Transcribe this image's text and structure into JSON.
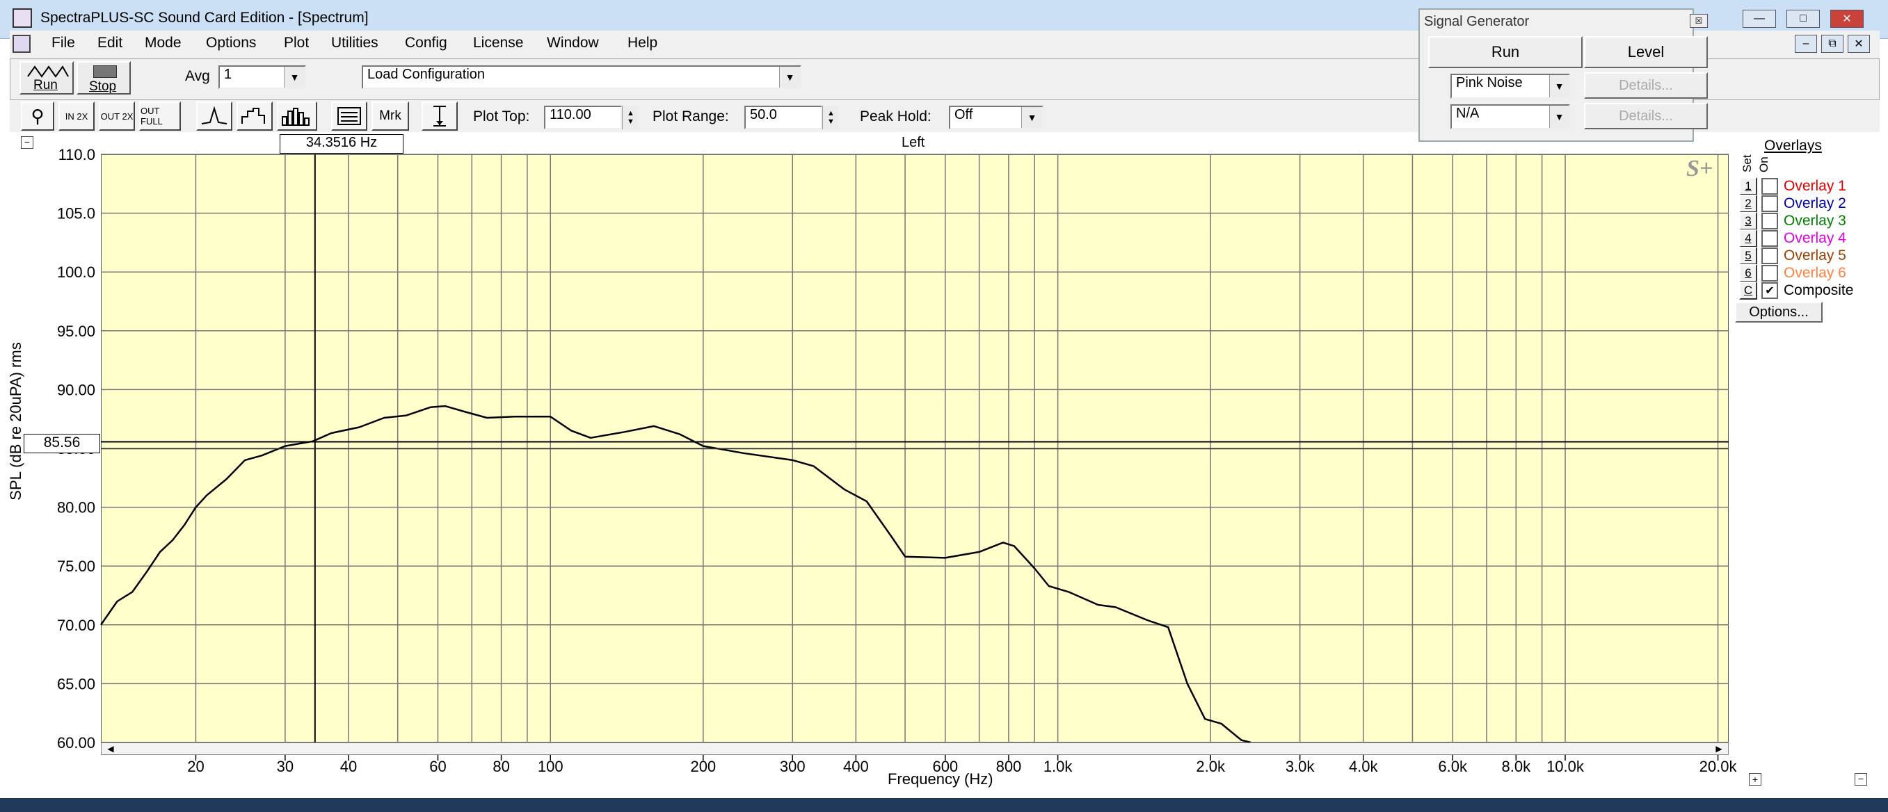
{
  "window": {
    "title": "SpectraPLUS-SC Sound Card Edition - [Spectrum]"
  },
  "menu": [
    "File",
    "Edit",
    "Mode",
    "Options",
    "Plot",
    "Utilities",
    "Config",
    "License",
    "Window",
    "Help"
  ],
  "toolbar": {
    "run_label": "Run",
    "stop_label": "Stop",
    "avg_label": "Avg",
    "avg_value": "1",
    "config_value": "Load Configuration"
  },
  "toolbar2": {
    "mrk_label": "Mrk",
    "plot_top_label": "Plot Top:",
    "plot_top_value": "110.00",
    "plot_range_label": "Plot Range:",
    "plot_range_value": "50.0",
    "peak_hold_label": "Peak Hold:",
    "peak_hold_value": "Off"
  },
  "signal_generator": {
    "title": "Signal Generator",
    "run_label": "Run",
    "level_label": "Level",
    "gen1_value": "Pink Noise",
    "gen2_value": "N/A",
    "details1_label": "Details...",
    "details2_label": "Details..."
  },
  "plot": {
    "cursor_readout": "34.3516 Hz",
    "channel_label": "Left",
    "cursor_level": "85.56",
    "watermark": "S+"
  },
  "overlays": {
    "title": "Overlays",
    "set_header": "Set",
    "on_header": "On",
    "items": [
      {
        "set": "1",
        "label": "Overlay 1",
        "color": "#e00000",
        "checked": false
      },
      {
        "set": "2",
        "label": "Overlay 2",
        "color": "#0000b0",
        "checked": false
      },
      {
        "set": "3",
        "label": "Overlay 3",
        "color": "#008000",
        "checked": false
      },
      {
        "set": "4",
        "label": "Overlay 4",
        "color": "#e000e0",
        "checked": false
      },
      {
        "set": "5",
        "label": "Overlay 5",
        "color": "#a04000",
        "checked": false
      },
      {
        "set": "6",
        "label": "Overlay 6",
        "color": "#ff8040",
        "checked": false
      },
      {
        "set": "C",
        "label": "Composite",
        "color": "#000000",
        "checked": true
      }
    ],
    "options_label": "Options..."
  },
  "chart_data": {
    "type": "line",
    "xlabel": "Frequency (Hz)",
    "ylabel": "SPL (dB re 20uPA) rms",
    "xscale": "log",
    "xlim": [
      13,
      21000
    ],
    "ylim": [
      60,
      110
    ],
    "yticks": [
      "110.0",
      "105.0",
      "100.0",
      "95.00",
      "90.00",
      "85.00",
      "80.00",
      "75.00",
      "70.00",
      "65.00",
      "60.00"
    ],
    "xtick_labels": [
      {
        "f": 20,
        "label": "20"
      },
      {
        "f": 30,
        "label": "30"
      },
      {
        "f": 40,
        "label": "40"
      },
      {
        "f": 60,
        "label": "60"
      },
      {
        "f": 80,
        "label": "80"
      },
      {
        "f": 100,
        "label": "100"
      },
      {
        "f": 200,
        "label": "200"
      },
      {
        "f": 300,
        "label": "300"
      },
      {
        "f": 400,
        "label": "400"
      },
      {
        "f": 600,
        "label": "600"
      },
      {
        "f": 800,
        "label": "800"
      },
      {
        "f": 1000,
        "label": "1.0k"
      },
      {
        "f": 2000,
        "label": "2.0k"
      },
      {
        "f": 3000,
        "label": "3.0k"
      },
      {
        "f": 4000,
        "label": "4.0k"
      },
      {
        "f": 6000,
        "label": "6.0k"
      },
      {
        "f": 8000,
        "label": "8.0k"
      },
      {
        "f": 10000,
        "label": "10.0k"
      },
      {
        "f": 20000,
        "label": "20.0k"
      }
    ],
    "grid_freqs": [
      20,
      30,
      40,
      50,
      60,
      70,
      80,
      90,
      100,
      200,
      300,
      400,
      500,
      600,
      700,
      800,
      900,
      1000,
      2000,
      3000,
      4000,
      5000,
      6000,
      7000,
      8000,
      9000,
      10000,
      20000
    ],
    "cursor_freq": 34.3516,
    "cursor_level": 85.56,
    "series": [
      {
        "color": "#000000",
        "points": [
          [
            13,
            70.0
          ],
          [
            14,
            72.0
          ],
          [
            15,
            72.8
          ],
          [
            16,
            74.5
          ],
          [
            17,
            76.2
          ],
          [
            18,
            77.2
          ],
          [
            19,
            78.5
          ],
          [
            20,
            80.0
          ],
          [
            21,
            81.0
          ],
          [
            23,
            82.4
          ],
          [
            25,
            84.0
          ],
          [
            27,
            84.4
          ],
          [
            30,
            85.2
          ],
          [
            34,
            85.6
          ],
          [
            37,
            86.3
          ],
          [
            42,
            86.8
          ],
          [
            47,
            87.6
          ],
          [
            52,
            87.8
          ],
          [
            58,
            88.5
          ],
          [
            62,
            88.6
          ],
          [
            68,
            88.1
          ],
          [
            75,
            87.6
          ],
          [
            85,
            87.7
          ],
          [
            100,
            87.7
          ],
          [
            110,
            86.5
          ],
          [
            120,
            85.9
          ],
          [
            140,
            86.4
          ],
          [
            160,
            86.9
          ],
          [
            180,
            86.2
          ],
          [
            200,
            85.2
          ],
          [
            240,
            84.6
          ],
          [
            300,
            84.0
          ],
          [
            330,
            83.5
          ],
          [
            380,
            81.5
          ],
          [
            420,
            80.5
          ],
          [
            470,
            77.5
          ],
          [
            500,
            75.8
          ],
          [
            600,
            75.7
          ],
          [
            700,
            76.2
          ],
          [
            780,
            77.0
          ],
          [
            820,
            76.7
          ],
          [
            900,
            74.8
          ],
          [
            960,
            73.3
          ],
          [
            1050,
            72.8
          ],
          [
            1200,
            71.7
          ],
          [
            1300,
            71.5
          ],
          [
            1500,
            70.4
          ],
          [
            1650,
            69.8
          ],
          [
            1800,
            65.0
          ],
          [
            1950,
            62.0
          ],
          [
            2100,
            61.6
          ],
          [
            2300,
            60.2
          ],
          [
            2400,
            60.0
          ]
        ]
      }
    ]
  }
}
